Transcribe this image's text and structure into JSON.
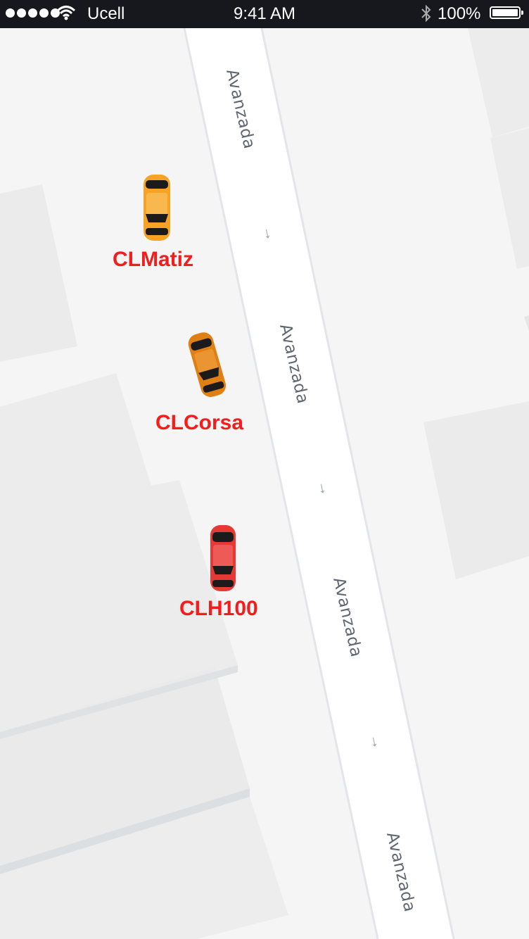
{
  "status_bar": {
    "carrier": "Ucell",
    "time": "9:41 AM",
    "battery_percent": "100%",
    "signal_bars": 5,
    "icons": [
      "signal-dots-icon",
      "wifi-icon",
      "bluetooth-icon",
      "battery-icon"
    ]
  },
  "map": {
    "road_labels": [
      "Avanzada",
      "Avanzada",
      "Avanzada",
      "Avanzada"
    ],
    "road_direction_arrows": 3
  },
  "vehicles": [
    {
      "label": "CLMatiz",
      "color": "#f7a326"
    },
    {
      "label": "CLCorsa",
      "color": "#e07f14"
    },
    {
      "label": "CLH100",
      "color": "#e53935"
    }
  ],
  "colors": {
    "label_text": "#f51c1c",
    "road": "#ffffff",
    "block": "#ececec",
    "background": "#f5f5f5"
  }
}
